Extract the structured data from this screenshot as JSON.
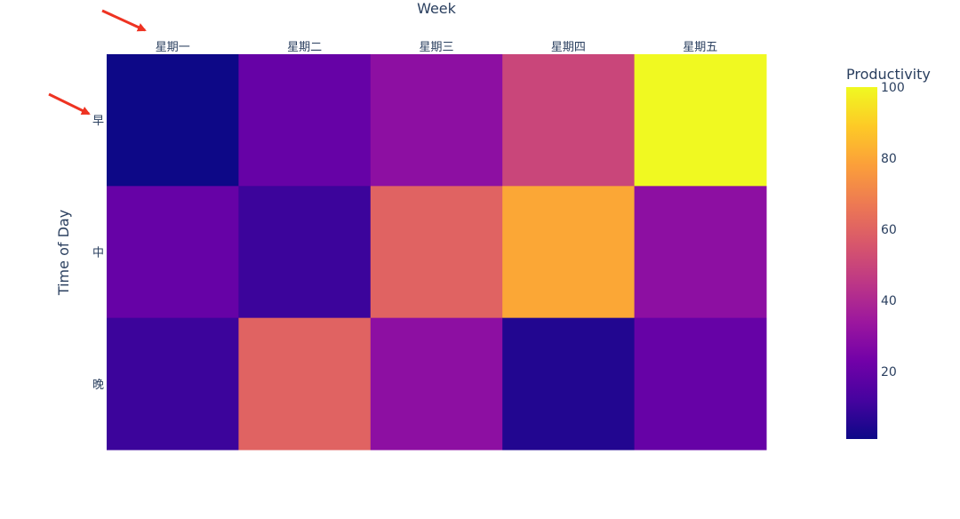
{
  "chart_data": {
    "type": "heatmap",
    "x_title": "Week",
    "y_title": "Time of Day",
    "categories": [
      "星期一",
      "星期二",
      "星期三",
      "星期四",
      "星期五"
    ],
    "rows": [
      "早",
      "中",
      "晚"
    ],
    "values": [
      [
        1,
        20,
        30,
        50,
        100
      ],
      [
        20,
        10,
        60,
        80,
        30
      ],
      [
        10,
        60,
        30,
        5,
        20
      ]
    ],
    "x_axis_position": "top",
    "colorscale": "plasma",
    "colorbar": {
      "title": "Productivity",
      "range": [
        1,
        100
      ],
      "ticks": [
        20,
        40,
        60,
        80,
        100
      ]
    },
    "annotations": [
      "red arrow pointing at 星期一 tick label",
      "red arrow pointing at 早 tick label"
    ],
    "arrow_color": "#ee3322"
  }
}
